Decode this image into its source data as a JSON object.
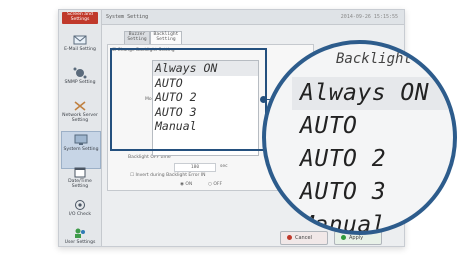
{
  "app": {
    "title": "Screen and Settings"
  },
  "header": {
    "title": "System Setting",
    "datetime": "2014-09-26 15:15:55"
  },
  "sidebar": {
    "items": [
      {
        "label": "E-Mail Setting"
      },
      {
        "label": "SNMP Setting"
      },
      {
        "label": "Network Server Setting"
      },
      {
        "label": "System Setting"
      },
      {
        "label": "Date/Time Setting"
      },
      {
        "label": "I/O Check"
      },
      {
        "label": "User Settings"
      }
    ]
  },
  "tabs": [
    {
      "label": "Buzzer Setting"
    },
    {
      "label": "Backlight Setting"
    }
  ],
  "panel": {
    "group_label": "Change Backlight Setting",
    "mode_label": "Mode:",
    "options": [
      "Always ON",
      "AUTO",
      "AUTO 2",
      "AUTO 3",
      "Manual"
    ],
    "selected": "Always ON",
    "off_time_label": "Backlight OFF time",
    "off_time_value": "180",
    "off_time_unit": "sec",
    "invert_label": "Invert during Backlight Error IN",
    "radio_on": "ON",
    "radio_off": "OFF"
  },
  "buttons": {
    "cancel": "Cancel",
    "apply": "Apply"
  },
  "zoom": {
    "title": "Backlight Setting"
  },
  "colors": {
    "accent": "#24507e",
    "cancel_icon": "#c0392b",
    "apply_icon": "#2e9b3c"
  }
}
